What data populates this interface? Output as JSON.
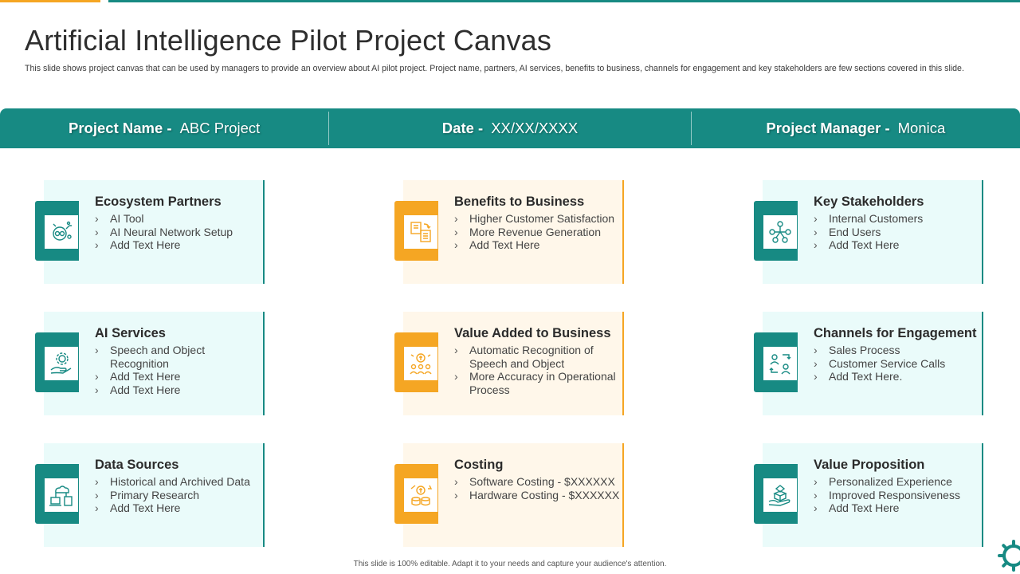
{
  "title": "Artificial Intelligence Pilot Project Canvas",
  "subtitle": "This slide shows project canvas that can be used by managers to provide an overview about AI pilot project. Project name, partners, AI services, benefits to business, channels for engagement and key stakeholders are few sections covered in this slide.",
  "header": {
    "project_name_label": "Project Name -",
    "project_name_value": "ABC Project",
    "date_label": "Date -",
    "date_value": "XX/XX/XXXX",
    "manager_label": "Project Manager -",
    "manager_value": "Monica"
  },
  "colors": {
    "teal": "#178a83",
    "orange": "#f5a623",
    "teal_panel": "#eafbfa",
    "orange_panel": "#fff7ea"
  },
  "cards": [
    {
      "title": "Ecosystem  Partners",
      "icon": "ai-brain-icon",
      "items": [
        "AI Tool",
        "AI Neural Network Setup",
        "Add Text Here"
      ]
    },
    {
      "title": "Benefits to Business",
      "icon": "business-documents-icon",
      "items": [
        "Higher Customer Satisfaction",
        "More Revenue Generation",
        "Add Text Here"
      ]
    },
    {
      "title": "Key Stakeholders",
      "icon": "network-people-icon",
      "items": [
        "Internal Customers",
        "End Users",
        "Add Text Here"
      ]
    },
    {
      "title": "AI Services",
      "icon": "gear-hand-icon",
      "items": [
        "Speech and Object Recognition",
        "Add Text Here",
        "Add Text Here"
      ]
    },
    {
      "title": "Value Added to Business",
      "icon": "value-people-icon",
      "items": [
        "Automatic Recognition of Speech and Object",
        "More Accuracy in Operational Process"
      ]
    },
    {
      "title": "Channels for Engagement",
      "icon": "exchange-users-icon",
      "items": [
        "Sales Process",
        "Customer Service Calls",
        "Add Text Here."
      ]
    },
    {
      "title": "Data Sources",
      "icon": "cloud-devices-icon",
      "items": [
        "Historical and Archived Data",
        "Primary Research",
        "Add Text Here"
      ]
    },
    {
      "title": "Costing",
      "icon": "coins-growth-icon",
      "items": [
        "Software Costing - $XXXXXX",
        "Hardware Costing - $XXXXXX"
      ]
    },
    {
      "title": "Value Proposition",
      "icon": "gift-box-hand-icon",
      "items": [
        "Personalized Experience",
        "Improved Responsiveness",
        "Add Text Here"
      ]
    }
  ],
  "footer": "This slide is 100% editable. Adapt it to your needs and capture your audience's attention."
}
